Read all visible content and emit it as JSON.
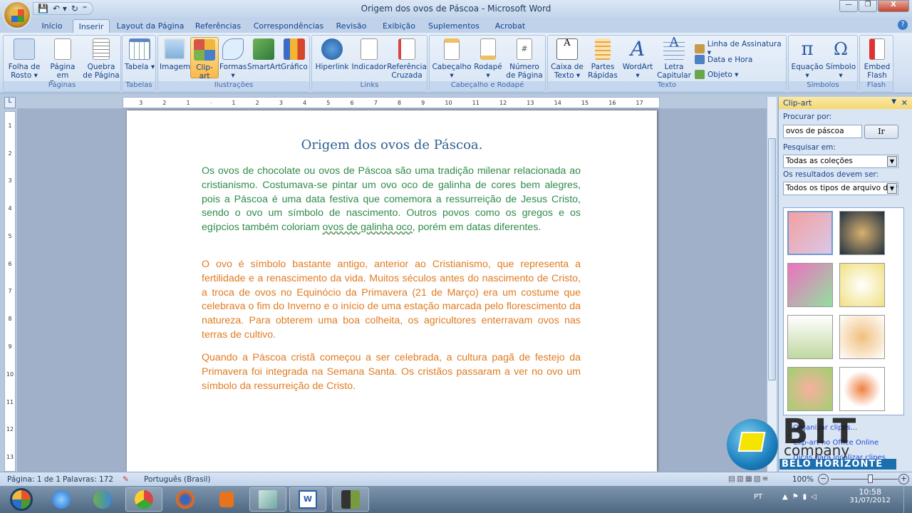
{
  "window": {
    "title": "Origem dos ovos de Páscoa - Microsoft Word",
    "minimize": "—",
    "maximize": "❐",
    "close": "X"
  },
  "qat": {
    "save": "💾",
    "undo": "↶ ▾",
    "redo": "↻",
    "customize": "⁼"
  },
  "tabs": [
    "Início",
    "Inserir",
    "Layout da Página",
    "Referências",
    "Correspondências",
    "Revisão",
    "Exibição",
    "Suplementos",
    "Acrobat"
  ],
  "active_tab": "Inserir",
  "help": "?",
  "ribbon": {
    "groups": [
      {
        "label": "Páginas",
        "buttons": [
          "Folha de Rosto ▾",
          "Página em Branco",
          "Quebra de Página"
        ]
      },
      {
        "label": "Tabelas",
        "buttons": [
          "Tabela ▾"
        ]
      },
      {
        "label": "Ilustrações",
        "buttons": [
          "Imagem",
          "Clip-art",
          "Formas ▾",
          "SmartArt",
          "Gráfico"
        ]
      },
      {
        "label": "Links",
        "buttons": [
          "Hiperlink",
          "Indicador",
          "Referência Cruzada"
        ]
      },
      {
        "label": "Cabeçalho e Rodapé",
        "buttons": [
          "Cabeçalho ▾",
          "Rodapé ▾",
          "Número de Página ▾"
        ]
      },
      {
        "label": "Texto",
        "buttons": [
          "Caixa de Texto ▾",
          "Partes Rápidas ▾",
          "WordArt ▾",
          "Letra Capitular ▾"
        ],
        "small": [
          "Linha de Assinatura ▾",
          "Data e Hora",
          "Objeto ▾"
        ]
      },
      {
        "label": "Símbolos",
        "buttons": [
          "Equação ▾",
          "Símbolo ▾"
        ]
      },
      {
        "label": "Flash",
        "buttons": [
          "Embed Flash"
        ]
      }
    ],
    "selected_button": "Clip-art"
  },
  "ruler": {
    "corner": "L",
    "numbers": [
      "3",
      "2",
      "1",
      "·",
      "1",
      "2",
      "3",
      "4",
      "5",
      "6",
      "7",
      "8",
      "9",
      "10",
      "11",
      "12",
      "13",
      "14",
      "15",
      "16",
      "17"
    ],
    "vnumbers": [
      "1",
      "2",
      "3",
      "4",
      "5",
      "6",
      "7",
      "8",
      "9",
      "10",
      "11",
      "12",
      "13"
    ]
  },
  "document": {
    "heading": "Origem dos ovos de Páscoa.",
    "p1_a": "Os ovos de chocolate ou ovos de Páscoa são uma tradição milenar relacionada ao cristianismo. Costumava-se pintar um ovo oco de galinha de cores bem alegres, pois a Páscoa é uma data festiva que comemora a ressurreição de Jesus Cristo, sendo o ovo um símbolo de nascimento. Outros povos como os gregos e os egípcios também coloriam ",
    "p1_misspelled": "ovos de galinha oco",
    "p1_b": ", porém em datas diferentes.",
    "p2": "O ovo é símbolo bastante antigo, anterior ao Cristianismo, que representa a fertilidade e a renascimento da vida. Muitos séculos antes do nascimento de Cristo, a troca de ovos no Equinócio da Primavera (21 de Março) era um costume que celebrava o fim do Inverno e o início de uma estação marcada pelo florescimento da natureza. Para obterem uma boa colheita, os agricultores enterravam ovos nas terras de cultivo.",
    "p3": "Quando a Páscoa cristã começou a ser celebrada, a cultura pagã de festejo da Primavera foi integrada na Semana Santa. Os cristãos passaram a ver no ovo um símbolo da ressurreição de Cristo.",
    "colors": {
      "heading": "#2c5f8f",
      "p1": "#2e8b4a",
      "p2": "#e07b20",
      "p3": "#e07b20"
    }
  },
  "clipart_pane": {
    "title": "Clip-art",
    "search_label": "Procurar por:",
    "search_value": "ovos de páscoa",
    "go_button": "Ir",
    "search_in_label": "Pesquisar em:",
    "search_in_value": "Todas as coleções",
    "results_label": "Os resultados devem ser:",
    "results_value": "Todos os tipos de arquivo de mí",
    "links": [
      "Organizar clipes...",
      "Clip-art no Office Online",
      "Dicas para localizar clipes"
    ],
    "thumbnails": 8
  },
  "watermark": {
    "line1": "BIT",
    "line2": "company",
    "line3": "BELO HORIZONTE"
  },
  "statusbar": {
    "page": "Página: 1 de 1",
    "words": "Palavras: 172",
    "language": "Português (Brasil)",
    "zoom": "100%",
    "zoom_out": "−",
    "zoom_in": "+",
    "zoom_percent": 100
  },
  "taskbar": {
    "apps": [
      "start",
      "internet-explorer",
      "messenger",
      "chrome",
      "firefox",
      "media-player",
      "notepad",
      "word",
      "camera"
    ],
    "lang": "PT",
    "time": "10:58",
    "date": "31/07/2012"
  }
}
